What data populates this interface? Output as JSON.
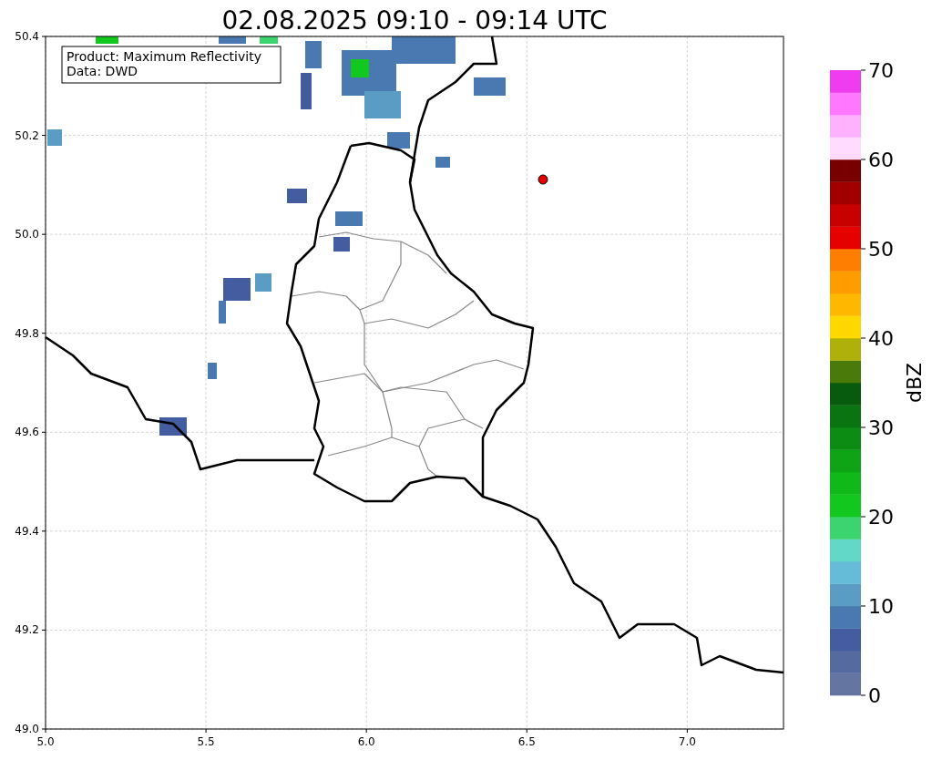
{
  "title": "02.08.2025 09:10 - 09:14 UTC",
  "annotation": [
    "Product: Maximum Reflectivity",
    "Data: DWD"
  ],
  "x_axis": {
    "ticks": [
      "5.0",
      "5.5",
      "6.0",
      "6.5",
      "7.0"
    ]
  },
  "y_axis": {
    "ticks": [
      "50.4",
      "50.2",
      "50.0",
      "49.8",
      "49.6",
      "49.4",
      "49.2",
      "49.0"
    ]
  },
  "colorbar": {
    "label": "dBZ",
    "ticks": [
      "70",
      "60",
      "50",
      "40",
      "30",
      "20",
      "10",
      "0"
    ],
    "segments": [
      {
        "color": "#6475a3"
      },
      {
        "color": "#556a9f"
      },
      {
        "color": "#445da0"
      },
      {
        "color": "#4a78b0"
      },
      {
        "color": "#5a9cc4"
      },
      {
        "color": "#64bcd8"
      },
      {
        "color": "#64d8c8"
      },
      {
        "color": "#3cd46e"
      },
      {
        "color": "#12c81e"
      },
      {
        "color": "#10b81a"
      },
      {
        "color": "#0ea416"
      },
      {
        "color": "#0c8c12"
      },
      {
        "color": "#0a7410"
      },
      {
        "color": "#085a0c"
      },
      {
        "color": "#4a7a0a"
      },
      {
        "color": "#b0b00a"
      },
      {
        "color": "#ffd800"
      },
      {
        "color": "#ffb800"
      },
      {
        "color": "#ff9c00"
      },
      {
        "color": "#ff7e00"
      },
      {
        "color": "#e60000"
      },
      {
        "color": "#c80000"
      },
      {
        "color": "#a00000"
      },
      {
        "color": "#780000"
      },
      {
        "color": "#ffdcff"
      },
      {
        "color": "#ffb0ff"
      },
      {
        "color": "#ff78ff"
      },
      {
        "color": "#f03cf0"
      }
    ]
  }
}
